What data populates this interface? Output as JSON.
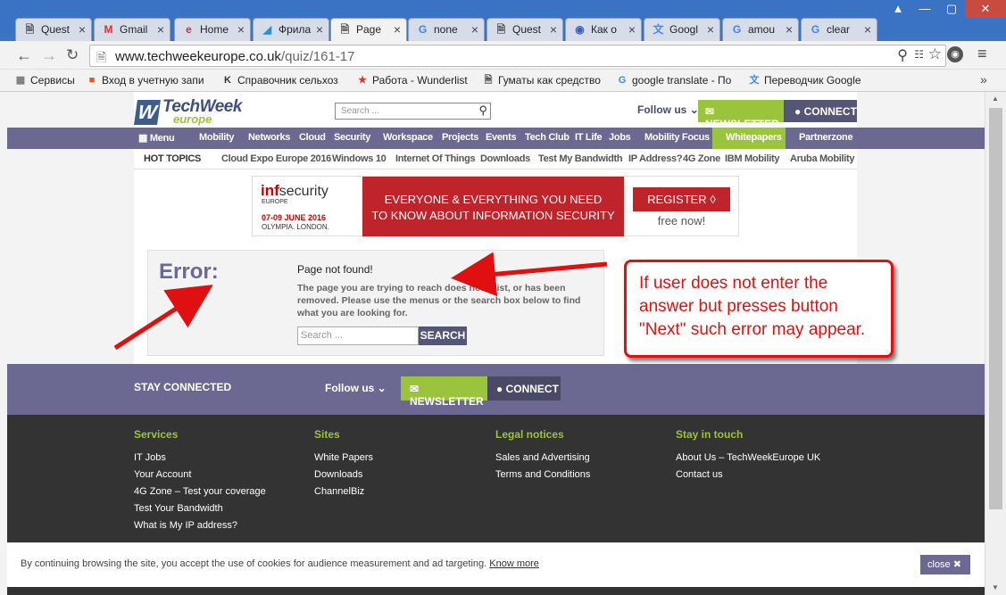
{
  "browser": {
    "tabs": [
      {
        "label": "Quest",
        "icon": "document-icon"
      },
      {
        "label": "Gmail",
        "icon": "gmail-icon"
      },
      {
        "label": "Home",
        "icon": "home-logo-icon"
      },
      {
        "label": "Фрила",
        "icon": "freelance-icon"
      },
      {
        "label": "Page",
        "icon": "document-icon"
      },
      {
        "label": "none",
        "icon": "google-icon"
      },
      {
        "label": "Quest",
        "icon": "document-icon"
      },
      {
        "label": "Как о",
        "icon": "globe-icon"
      },
      {
        "label": "Googl",
        "icon": "translate-icon"
      },
      {
        "label": "amou",
        "icon": "google-icon"
      },
      {
        "label": "clear",
        "icon": "google-icon"
      }
    ],
    "url_host": "www.techweekeurope.co.uk",
    "url_path": "/quiz/161-17",
    "bookmarks": [
      {
        "label": "Сервисы",
        "icon": "apps-icon"
      },
      {
        "label": "Вход в учетную запи",
        "icon": "microsoft-icon"
      },
      {
        "label": "Справочник сельхоз",
        "icon": "k-icon"
      },
      {
        "label": "Работа - Wunderlist",
        "icon": "wunderlist-icon"
      },
      {
        "label": "Гуматы как средство",
        "icon": "document-icon"
      },
      {
        "label": "google translate - По",
        "icon": "google-icon"
      },
      {
        "label": "Переводчик Google",
        "icon": "translate-icon"
      }
    ],
    "bookmarks_more": "»"
  },
  "header": {
    "logo_top": "TechWeek",
    "logo_bottom": "europe",
    "logo_mark": "W",
    "search_placeholder": "Search ...",
    "follow_us": "Follow us",
    "newsletter": "NEWSLETTER",
    "connect": "CONNECT"
  },
  "nav": {
    "items": [
      "Menu",
      "Mobility",
      "Networks",
      "Cloud",
      "Security",
      "Workspace",
      "Projects",
      "Events",
      "Tech Club",
      "IT Life",
      "Jobs",
      "Mobility Focus",
      "Whitepapers",
      "Partnerzone"
    ]
  },
  "hot_topics": {
    "title": "HOT TOPICS",
    "items": [
      "Cloud Expo Europe 2016",
      "Windows 10",
      "Internet Of Things",
      "Downloads",
      "Test My Bandwidth",
      "IP Address?",
      "4G Zone",
      "IBM Mobility",
      "Aruba Mobility"
    ]
  },
  "banner": {
    "brand_a": "inf",
    "brand_b": "security",
    "region": "EUROPE",
    "dates": "07-09 JUNE 2016",
    "venue": "OLYMPIA. LONDON.",
    "line1": "EVERYONE & EVERYTHING YOU NEED",
    "line2": "TO KNOW ABOUT INFORMATION SECURITY",
    "register": "REGISTER",
    "free": "free now!"
  },
  "error": {
    "heading": "Error:",
    "title": "Page not found!",
    "message": "The page you are trying to reach does not exist, or has been removed. Please use the menus or the search box below to find what you are looking for.",
    "search_placeholder": "Search ...",
    "search_button": "SEARCH"
  },
  "annotation": {
    "text": "If user does not enter the answer but presses button \"Next\" such error may appear."
  },
  "footer": {
    "stay_connected": "STAY CONNECTED",
    "follow_us": "Follow us",
    "newsletter": "NEWSLETTER",
    "connect": "CONNECT",
    "columns": [
      {
        "title": "Services",
        "links": [
          "IT Jobs",
          "Your Account",
          "4G Zone – Test your coverage",
          "Test Your Bandwidth",
          "What is My IP address?"
        ]
      },
      {
        "title": "Sites",
        "links": [
          "White Papers",
          "Downloads",
          "ChannelBiz"
        ]
      },
      {
        "title": "Legal notices",
        "links": [
          "Sales and Advertising",
          "Terms and Conditions"
        ]
      },
      {
        "title": "Stay in touch",
        "links": [
          "About Us – TechWeekEurope UK",
          "Contact us"
        ]
      }
    ]
  },
  "cookie": {
    "text": "By continuing browsing the site, you accept the use of cookies for audience measurement and ad targeting.",
    "link": "Know more",
    "close": "close"
  },
  "colors": {
    "nav": "#6b6891",
    "green": "#9bc43d",
    "annotation": "#e01010",
    "footer": "#333333"
  }
}
